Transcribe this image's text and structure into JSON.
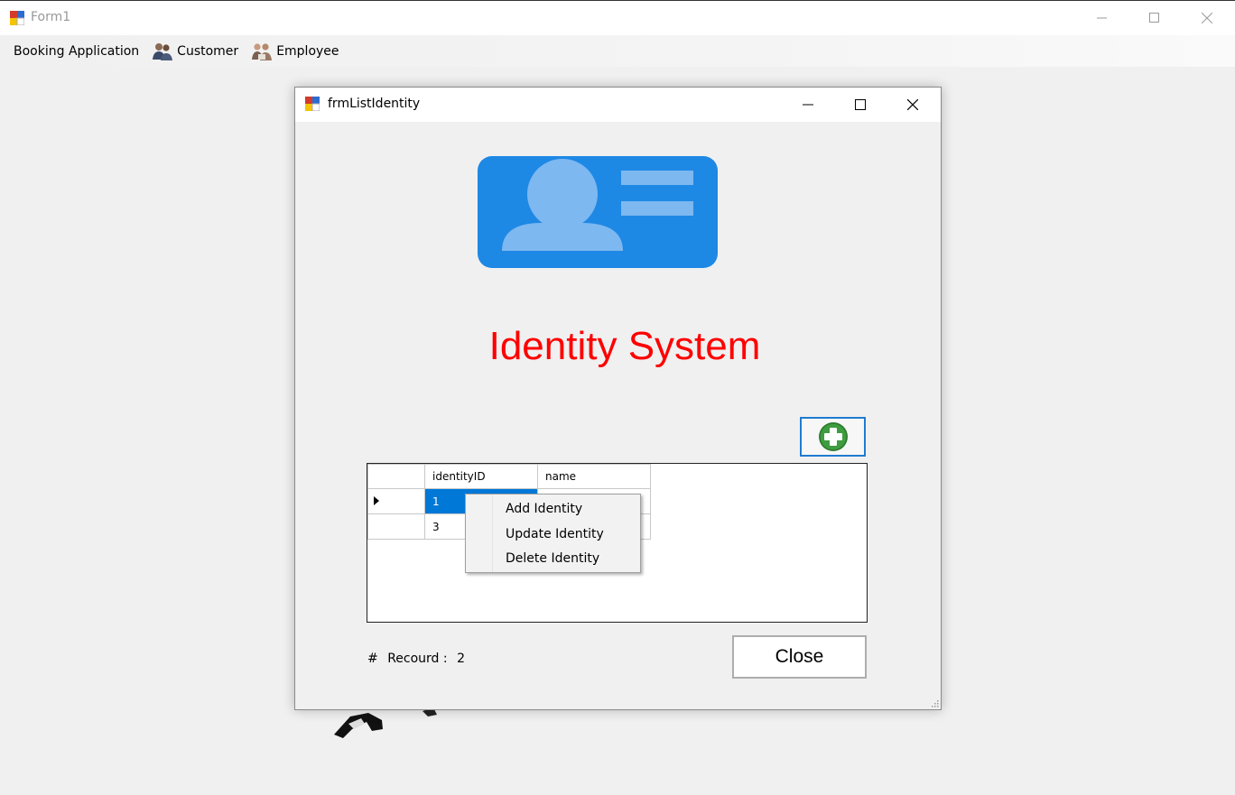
{
  "main_window": {
    "title": "Form1",
    "controls": [
      "minimize-icon",
      "maximize-icon",
      "close-icon"
    ]
  },
  "menubar": {
    "items": [
      {
        "label": "Booking Application",
        "icon": null
      },
      {
        "label": "Customer",
        "icon": "customers-icon"
      },
      {
        "label": "Employee",
        "icon": "employees-icon"
      }
    ]
  },
  "child_window": {
    "title": "frmListIdentity",
    "heading": "Identity System",
    "heading_color": "#ff0000",
    "card_icon": "id-card-icon",
    "add_button_icon": "plus-circle-icon",
    "grid": {
      "columns": [
        "identityID",
        "name"
      ],
      "rows": [
        {
          "identityID": "1",
          "name": "",
          "current": true,
          "selected": true
        },
        {
          "identityID": "3",
          "name": "",
          "current": false,
          "selected": false
        }
      ],
      "selection_color": "#0078d7"
    },
    "context_menu": {
      "items": [
        "Add Identity",
        "Update Identity",
        "Delete Identity"
      ]
    },
    "record": {
      "hash": "#",
      "label": "Recourd :",
      "count": "2"
    },
    "close_label": "Close"
  }
}
